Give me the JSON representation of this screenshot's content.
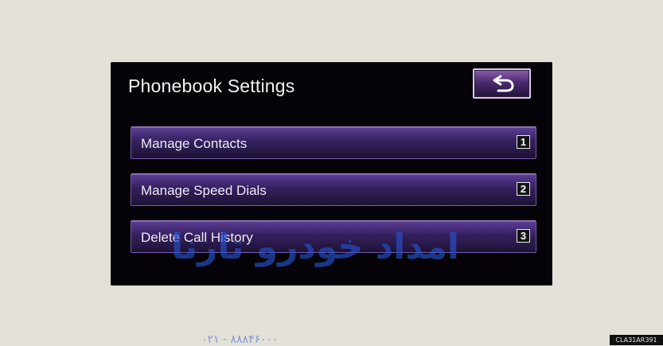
{
  "screen": {
    "title": "Phonebook Settings",
    "back_icon": "return-arrow-icon",
    "menu_items": [
      {
        "label": "Manage Contacts",
        "number": "1"
      },
      {
        "label": "Manage Speed Dials",
        "number": "2"
      },
      {
        "label": "Delete Call History",
        "number": "3"
      }
    ]
  },
  "overlay": {
    "watermark": "امداد خودرو تارنا",
    "phone": "۰۲۱ - ۸۸۸۴۶۰۰۰"
  },
  "footer": {
    "code": "CLA31AR391"
  },
  "colors": {
    "page_background": "#e3e1d7",
    "screen_background": "#050307",
    "menu_item_top": "#5c3e96",
    "menu_item_bottom": "#1d1235",
    "back_button_border": "#d8cbe4",
    "watermark_blue": "#2652cd"
  }
}
